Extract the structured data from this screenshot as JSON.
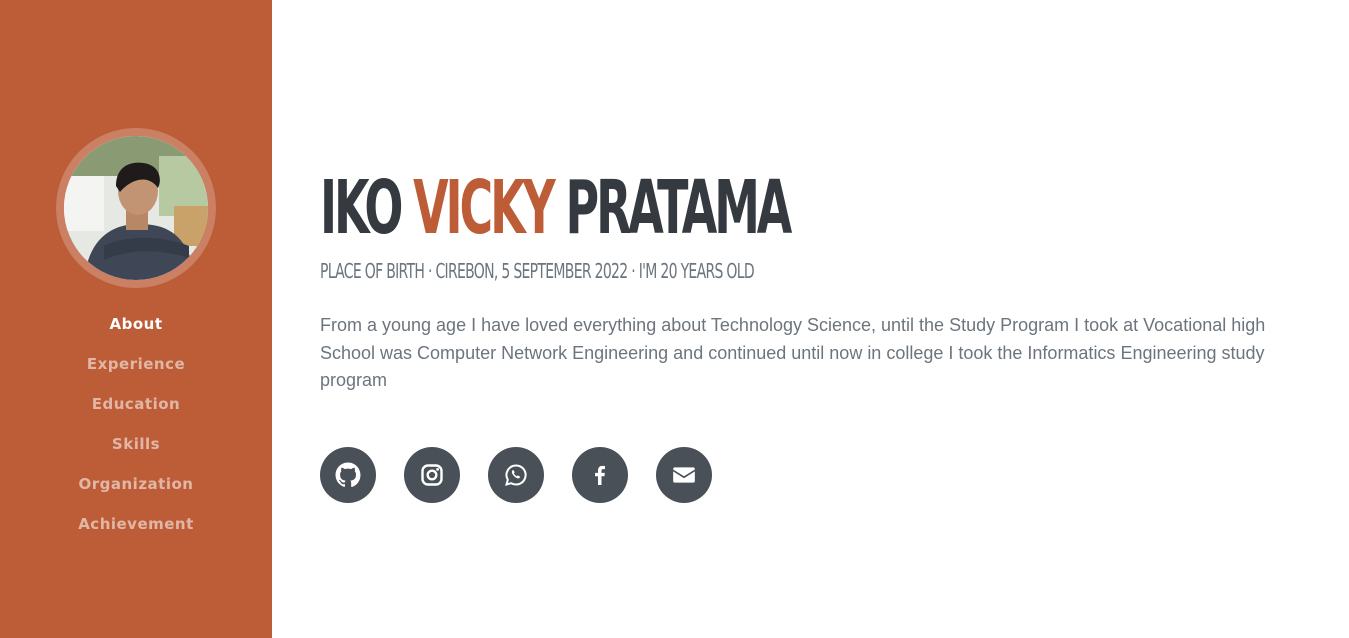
{
  "sidebar": {
    "avatar_alt": "Profile photo",
    "nav": [
      {
        "label": "About",
        "active": true
      },
      {
        "label": "Experience"
      },
      {
        "label": "Education"
      },
      {
        "label": "Skills"
      },
      {
        "label": "Organization"
      },
      {
        "label": "Achievement"
      }
    ]
  },
  "about": {
    "first_name": "Iko",
    "middle_name": "Vicky",
    "last_name": "Pratama",
    "subheading": "Place of Birth · Cirebon, 5 September 2022 · I'm 20 years old",
    "bio": "From a young age I have loved everything about Technology Science, until the Study Program I took at Vocational high School was Computer Network Engineering and continued until now in college I took the Informatics Engineering study program"
  },
  "social": [
    {
      "icon": "github-icon"
    },
    {
      "icon": "instagram-icon"
    },
    {
      "icon": "whatsapp-icon"
    },
    {
      "icon": "facebook-icon"
    },
    {
      "icon": "envelope-icon"
    }
  ],
  "colors": {
    "sidebar": "#bd5d38",
    "accent": "#bd5d38",
    "heading": "#343a40",
    "text": "#6c757d",
    "social_bg": "#495057"
  }
}
